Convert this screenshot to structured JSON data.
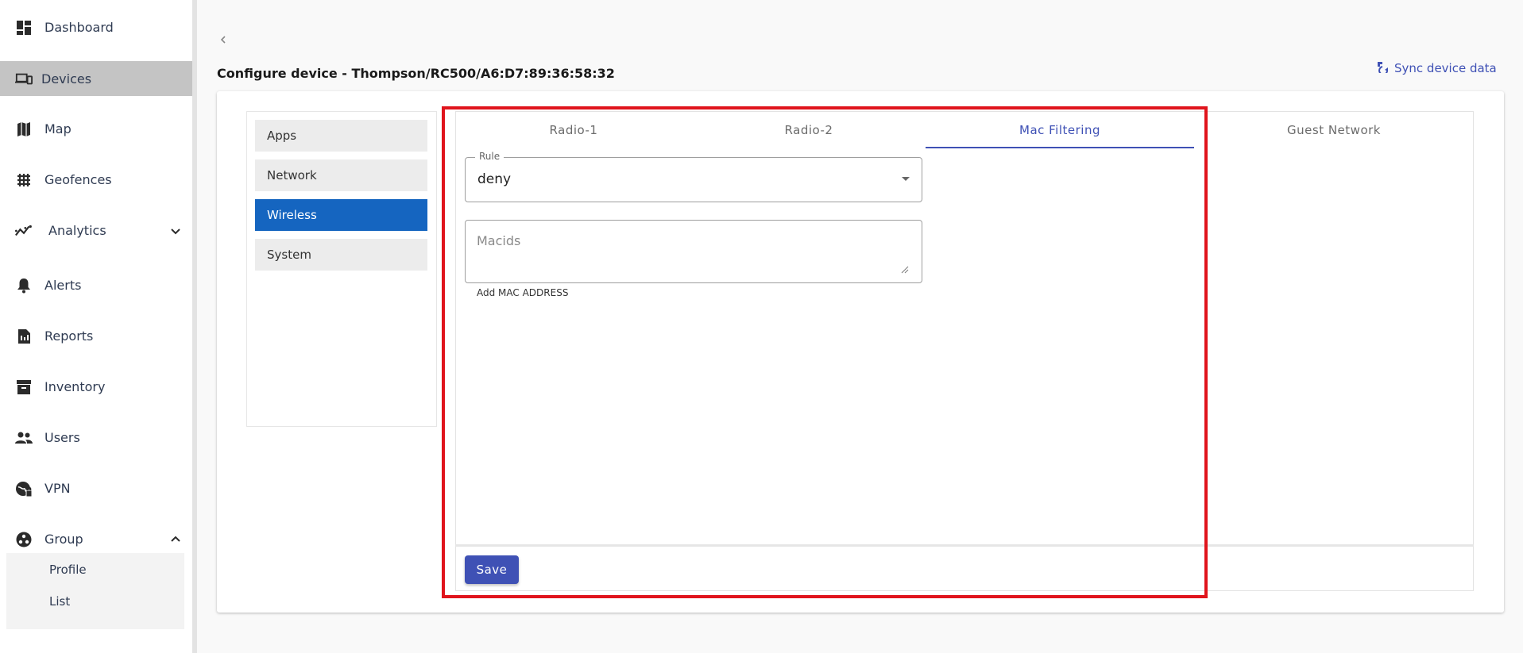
{
  "sidebar": {
    "items": [
      {
        "label": "Dashboard",
        "icon": "dashboard-icon"
      },
      {
        "label": "Devices",
        "icon": "devices-icon",
        "active": true
      },
      {
        "label": "Map",
        "icon": "map-icon"
      },
      {
        "label": "Geofences",
        "icon": "geofences-icon"
      },
      {
        "label": "Analytics",
        "icon": "analytics-icon",
        "expandable": true
      },
      {
        "label": "Alerts",
        "icon": "bell-icon"
      },
      {
        "label": "Reports",
        "icon": "reports-icon"
      },
      {
        "label": "Inventory",
        "icon": "inventory-icon"
      },
      {
        "label": "Users",
        "icon": "users-icon"
      },
      {
        "label": "VPN",
        "icon": "vpn-icon"
      },
      {
        "label": "Group",
        "icon": "group-icon",
        "expanded": true
      }
    ],
    "group_subitems": [
      {
        "label": "Profile"
      },
      {
        "label": "List"
      }
    ]
  },
  "header": {
    "title": "Configure device - Thompson/RC500/A6:D7:89:36:58:32",
    "sync_label": "Sync device data"
  },
  "config_menu": {
    "items": [
      {
        "label": "Apps"
      },
      {
        "label": "Network"
      },
      {
        "label": "Wireless",
        "active": true
      },
      {
        "label": "System"
      }
    ]
  },
  "tabs": [
    {
      "label": "Radio-1"
    },
    {
      "label": "Radio-2"
    },
    {
      "label": "Mac Filtering",
      "active": true
    },
    {
      "label": "Guest Network"
    }
  ],
  "form": {
    "rule": {
      "label": "Rule",
      "value": "deny"
    },
    "macids": {
      "placeholder": "Macids",
      "value": "",
      "helper": "Add MAC ADDRESS"
    },
    "save_label": "Save"
  },
  "colors": {
    "accent": "#3f51b5",
    "active_menu": "#1565c0",
    "highlight": "#e0141c",
    "nav_active": "#c4c4c4"
  }
}
